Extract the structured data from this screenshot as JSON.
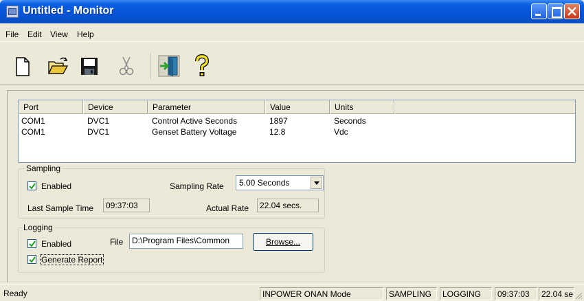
{
  "window": {
    "title": "Untitled - Monitor"
  },
  "menu": [
    {
      "label": "File"
    },
    {
      "label": "Edit"
    },
    {
      "label": "View"
    },
    {
      "label": "Help"
    }
  ],
  "toolbar": {
    "buttons": [
      "new-document-icon",
      "open-folder-icon",
      "save-disk-icon",
      "cut-scissors-icon",
      "exit-door-icon",
      "help-question-icon"
    ]
  },
  "list": {
    "columns": [
      "Port",
      "Device",
      "Parameter",
      "Value",
      "Units"
    ],
    "rows": [
      {
        "port": "COM1",
        "device": "DVC1",
        "parameter": "Control Active Seconds",
        "value": "1897",
        "units": "Seconds"
      },
      {
        "port": "COM1",
        "device": "DVC1",
        "parameter": "Genset Battery Voltage",
        "value": "12.8",
        "units": "Vdc"
      }
    ]
  },
  "sampling": {
    "legend": "Sampling",
    "enabled_label": "Enabled",
    "enabled": true,
    "rate_label": "Sampling Rate",
    "rate_value": "5.00 Seconds",
    "last_sample_label": "Last Sample Time",
    "last_sample_value": "09:37:03",
    "actual_rate_label": "Actual Rate",
    "actual_rate_value": "22.04 secs."
  },
  "logging": {
    "legend": "Logging",
    "enabled_label": "Enabled",
    "enabled": true,
    "file_label": "File",
    "file_value": "D:\\Program Files\\Common",
    "browse_label": "Browse...",
    "report_label": "Generate Report",
    "report": true
  },
  "status": {
    "ready": "Ready",
    "mode": "INPOWER ONAN Mode",
    "sampling": "SAMPLING",
    "logging": "LOGGING",
    "time": "09:37:03",
    "rate": "22.04 se"
  }
}
